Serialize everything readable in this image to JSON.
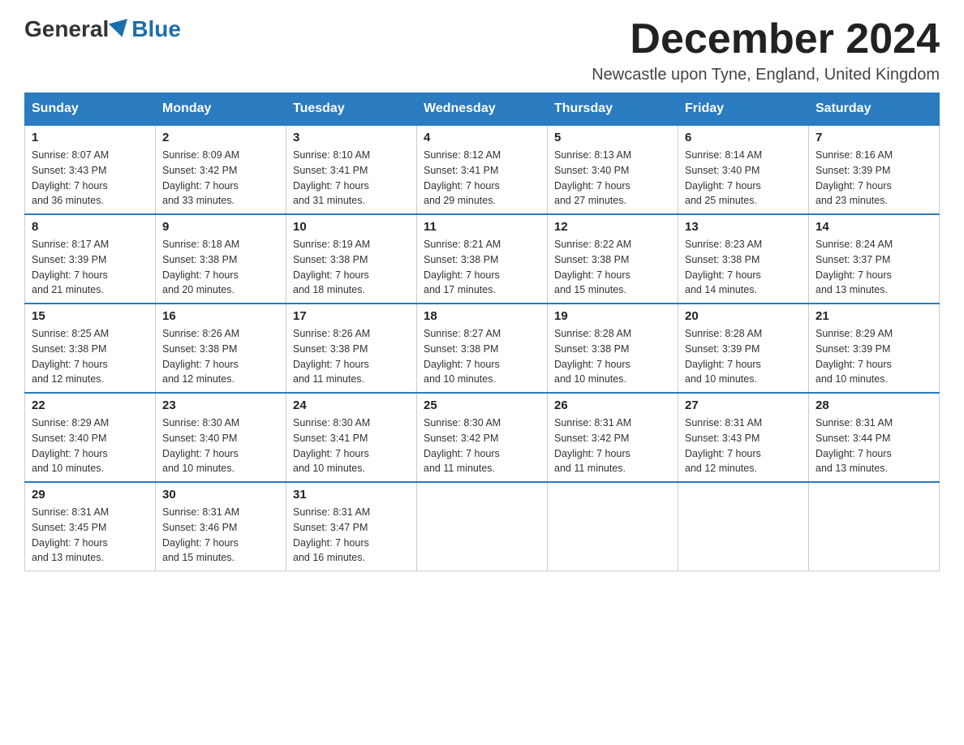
{
  "header": {
    "logo_general": "General",
    "logo_blue": "Blue",
    "month_title": "December 2024",
    "location": "Newcastle upon Tyne, England, United Kingdom"
  },
  "days_of_week": [
    "Sunday",
    "Monday",
    "Tuesday",
    "Wednesday",
    "Thursday",
    "Friday",
    "Saturday"
  ],
  "weeks": [
    [
      {
        "day": "1",
        "sunrise": "8:07 AM",
        "sunset": "3:43 PM",
        "daylight": "7 hours and 36 minutes."
      },
      {
        "day": "2",
        "sunrise": "8:09 AM",
        "sunset": "3:42 PM",
        "daylight": "7 hours and 33 minutes."
      },
      {
        "day": "3",
        "sunrise": "8:10 AM",
        "sunset": "3:41 PM",
        "daylight": "7 hours and 31 minutes."
      },
      {
        "day": "4",
        "sunrise": "8:12 AM",
        "sunset": "3:41 PM",
        "daylight": "7 hours and 29 minutes."
      },
      {
        "day": "5",
        "sunrise": "8:13 AM",
        "sunset": "3:40 PM",
        "daylight": "7 hours and 27 minutes."
      },
      {
        "day": "6",
        "sunrise": "8:14 AM",
        "sunset": "3:40 PM",
        "daylight": "7 hours and 25 minutes."
      },
      {
        "day": "7",
        "sunrise": "8:16 AM",
        "sunset": "3:39 PM",
        "daylight": "7 hours and 23 minutes."
      }
    ],
    [
      {
        "day": "8",
        "sunrise": "8:17 AM",
        "sunset": "3:39 PM",
        "daylight": "7 hours and 21 minutes."
      },
      {
        "day": "9",
        "sunrise": "8:18 AM",
        "sunset": "3:38 PM",
        "daylight": "7 hours and 20 minutes."
      },
      {
        "day": "10",
        "sunrise": "8:19 AM",
        "sunset": "3:38 PM",
        "daylight": "7 hours and 18 minutes."
      },
      {
        "day": "11",
        "sunrise": "8:21 AM",
        "sunset": "3:38 PM",
        "daylight": "7 hours and 17 minutes."
      },
      {
        "day": "12",
        "sunrise": "8:22 AM",
        "sunset": "3:38 PM",
        "daylight": "7 hours and 15 minutes."
      },
      {
        "day": "13",
        "sunrise": "8:23 AM",
        "sunset": "3:38 PM",
        "daylight": "7 hours and 14 minutes."
      },
      {
        "day": "14",
        "sunrise": "8:24 AM",
        "sunset": "3:37 PM",
        "daylight": "7 hours and 13 minutes."
      }
    ],
    [
      {
        "day": "15",
        "sunrise": "8:25 AM",
        "sunset": "3:38 PM",
        "daylight": "7 hours and 12 minutes."
      },
      {
        "day": "16",
        "sunrise": "8:26 AM",
        "sunset": "3:38 PM",
        "daylight": "7 hours and 12 minutes."
      },
      {
        "day": "17",
        "sunrise": "8:26 AM",
        "sunset": "3:38 PM",
        "daylight": "7 hours and 11 minutes."
      },
      {
        "day": "18",
        "sunrise": "8:27 AM",
        "sunset": "3:38 PM",
        "daylight": "7 hours and 10 minutes."
      },
      {
        "day": "19",
        "sunrise": "8:28 AM",
        "sunset": "3:38 PM",
        "daylight": "7 hours and 10 minutes."
      },
      {
        "day": "20",
        "sunrise": "8:28 AM",
        "sunset": "3:39 PM",
        "daylight": "7 hours and 10 minutes."
      },
      {
        "day": "21",
        "sunrise": "8:29 AM",
        "sunset": "3:39 PM",
        "daylight": "7 hours and 10 minutes."
      }
    ],
    [
      {
        "day": "22",
        "sunrise": "8:29 AM",
        "sunset": "3:40 PM",
        "daylight": "7 hours and 10 minutes."
      },
      {
        "day": "23",
        "sunrise": "8:30 AM",
        "sunset": "3:40 PM",
        "daylight": "7 hours and 10 minutes."
      },
      {
        "day": "24",
        "sunrise": "8:30 AM",
        "sunset": "3:41 PM",
        "daylight": "7 hours and 10 minutes."
      },
      {
        "day": "25",
        "sunrise": "8:30 AM",
        "sunset": "3:42 PM",
        "daylight": "7 hours and 11 minutes."
      },
      {
        "day": "26",
        "sunrise": "8:31 AM",
        "sunset": "3:42 PM",
        "daylight": "7 hours and 11 minutes."
      },
      {
        "day": "27",
        "sunrise": "8:31 AM",
        "sunset": "3:43 PM",
        "daylight": "7 hours and 12 minutes."
      },
      {
        "day": "28",
        "sunrise": "8:31 AM",
        "sunset": "3:44 PM",
        "daylight": "7 hours and 13 minutes."
      }
    ],
    [
      {
        "day": "29",
        "sunrise": "8:31 AM",
        "sunset": "3:45 PM",
        "daylight": "7 hours and 13 minutes."
      },
      {
        "day": "30",
        "sunrise": "8:31 AM",
        "sunset": "3:46 PM",
        "daylight": "7 hours and 15 minutes."
      },
      {
        "day": "31",
        "sunrise": "8:31 AM",
        "sunset": "3:47 PM",
        "daylight": "7 hours and 16 minutes."
      },
      null,
      null,
      null,
      null
    ]
  ],
  "labels": {
    "sunrise": "Sunrise:",
    "sunset": "Sunset:",
    "daylight": "Daylight:"
  }
}
